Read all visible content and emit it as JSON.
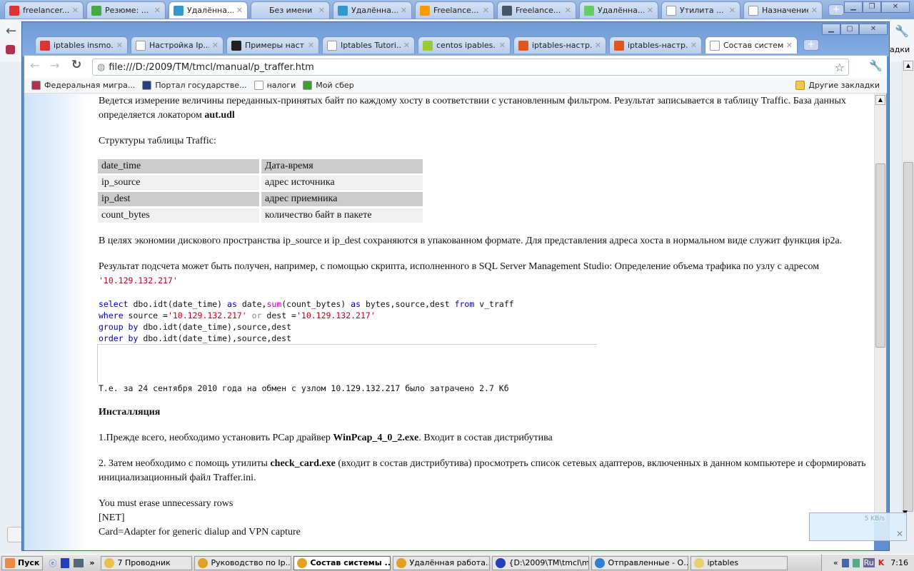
{
  "outer_tabs": [
    {
      "label": "freelancer...",
      "icon": "yandex-icon"
    },
    {
      "label": "Резюме: ...",
      "icon": "f-icon"
    },
    {
      "label": "Удалённа...",
      "icon": "remote-icon",
      "active": true
    },
    {
      "label": "Без имени",
      "icon": ""
    },
    {
      "label": "Удалённа...",
      "icon": "remote-icon"
    },
    {
      "label": "Freelance...",
      "icon": "freelance-icon"
    },
    {
      "label": "Freelance...",
      "icon": "diamond-icon"
    },
    {
      "label": "Удалённа...",
      "icon": "green-icon"
    },
    {
      "label": "Утилита ...",
      "icon": "page-icon"
    },
    {
      "label": "Назначение",
      "icon": "page-icon"
    }
  ],
  "outer_bookmark_tail": "адки",
  "inner_tabs": [
    {
      "label": "iptables insmo...",
      "icon": "yandex-icon"
    },
    {
      "label": "Настройка Ip...",
      "icon": "page-icon"
    },
    {
      "label": "Примеры наст...",
      "icon": "linux-icon"
    },
    {
      "label": "Iptables Tutori...",
      "icon": "page-icon"
    },
    {
      "label": "centos ipables...",
      "icon": "question-icon"
    },
    {
      "label": "iptables-настр...",
      "icon": "ubuntu-icon"
    },
    {
      "label": "iptables-настр...",
      "icon": "ubuntu-icon"
    },
    {
      "label": "Состав системы",
      "icon": "page-icon",
      "active": true
    }
  ],
  "address": "file:///D:/2009/TM/tmcl/manual/p_traffer.htm",
  "bookmarks": [
    {
      "label": "Федеральная мигра...",
      "color": "#b03050"
    },
    {
      "label": "Портал государстве...",
      "color": "#2a3f80"
    },
    {
      "label": "налоги",
      "color": "#ffffff"
    },
    {
      "label": "Мой сбер",
      "color": "#3aa030"
    }
  ],
  "other_bookmarks": "Другие закладки",
  "content": {
    "p1": "Ведется измерение величины переданных-принятых байт по каждому хосту в соответствии с установленным фильтром. Результат записывается в таблицу Traffic. База данных определяется локатором ",
    "p1_bold": "aut.udl",
    "p2": "Структуры таблицы Traffic:",
    "table": [
      [
        "date_time",
        "Дата-время"
      ],
      [
        "ip_source",
        "адрес источника"
      ],
      [
        "ip_dest",
        "адрес приемника"
      ],
      [
        "count_bytes",
        "количество байт в пакете"
      ]
    ],
    "p3": "В целях экономии дискового пространства ip_source и ip_dest сохраняются в упакованном формате. Для представления адреса хоста в   нормальном виде служит функция ip2a.",
    "p4": "Результат подсчета может быть получен, например, с помощью скрипта, исполненного в SQL Server Management Studio: Определение объема трафика по узлу  с адресом ",
    "p4_ip": "'10.129.132.217'",
    "code": {
      "select": "select",
      "l1a": " dbo.idt(date_time) ",
      "as": "as",
      "l1b": " date,",
      "sum": "sum",
      "l1c": "(count_bytes) ",
      "l1d": " bytes,source,dest ",
      "from": "from",
      "l1e": " v_traff",
      "where": "where",
      "l2a": " source =",
      "ip": "'10.129.132.217'",
      "or": " or",
      "l2b": " dest =",
      "group": "group by",
      "l3": " dbo.idt(date_time),source,dest",
      "order": "order by",
      "l4": " dbo.idt(date_time),source,dest"
    },
    "result": "Т.е. за 24 сентября 2010 года на обмен с узлом 10.129.132.217 было затрачено 2.7 Кб",
    "h_install": "Инсталляция",
    "s1": "1.Прежде всего, необходимо установить PCap драйвер ",
    "s1_bold": "WinPcap_4_0_2.exe",
    "s1_end": ". Входит в состав дистрибутива",
    "s2": "2. Затем необходимо с помощь утилиты ",
    "s2_bold": "check_card.exe",
    "s2_end": " (входит в состав дистрибутива) просмотреть список сетевых адаптеров, включенных в данном компьютере и сформировать инициализационный файл Traffer.ini.",
    "l1": "You must erase unnecessary rows",
    "l2": "[NET]",
    "l3": "Card=Adapter for generic dialup and VPN capture"
  },
  "notification": {
    "speed": "5 KB/s"
  },
  "taskbar": {
    "start": "Пуск",
    "tasks": [
      {
        "label": "7 Проводник",
        "color": "#e8c050"
      },
      {
        "label": "Руководство по Ip...",
        "color": "#e0a020"
      },
      {
        "label": "Состав системы ...",
        "color": "#e0a020",
        "active": true
      },
      {
        "label": "Удалённая работа...",
        "color": "#e0a020"
      },
      {
        "label": "{D:\\2009\\TM\\tmcl\\m...",
        "color": "#2040c0"
      },
      {
        "label": "Отправленные - О...",
        "color": "#3080d0"
      },
      {
        "label": "iptables",
        "color": "#e8d070"
      }
    ],
    "lang": "Ru",
    "clock": "7:16"
  }
}
